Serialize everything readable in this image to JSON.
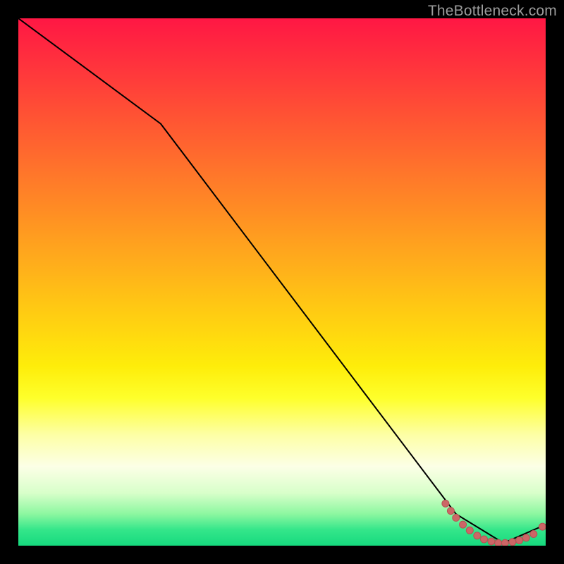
{
  "watermark": "TheBottleneck.com",
  "colors": {
    "line": "#000000",
    "marker_fill": "#cc6666",
    "marker_stroke": "#b35454"
  },
  "chart_data": {
    "type": "line",
    "title": "",
    "xlabel": "",
    "ylabel": "",
    "xlim": [
      0,
      100
    ],
    "ylim": [
      0,
      100
    ],
    "grid": false,
    "series": [
      {
        "name": "curve",
        "x": [
          0,
          27,
          83,
          92,
          100
        ],
        "y": [
          100,
          80,
          6,
          0.5,
          4
        ]
      }
    ],
    "markers": {
      "name": "dashed-segment",
      "points": [
        {
          "x": 81.0,
          "y": 8.0
        },
        {
          "x": 82.0,
          "y": 6.6
        },
        {
          "x": 83.0,
          "y": 5.3
        },
        {
          "x": 84.3,
          "y": 4.0
        },
        {
          "x": 85.6,
          "y": 2.9
        },
        {
          "x": 87.0,
          "y": 1.9
        },
        {
          "x": 88.3,
          "y": 1.2
        },
        {
          "x": 89.7,
          "y": 0.8
        },
        {
          "x": 91.0,
          "y": 0.5
        },
        {
          "x": 92.3,
          "y": 0.5
        },
        {
          "x": 93.7,
          "y": 0.7
        },
        {
          "x": 95.0,
          "y": 1.0
        },
        {
          "x": 96.3,
          "y": 1.5
        },
        {
          "x": 97.7,
          "y": 2.2
        },
        {
          "x": 99.4,
          "y": 3.6
        }
      ]
    }
  }
}
